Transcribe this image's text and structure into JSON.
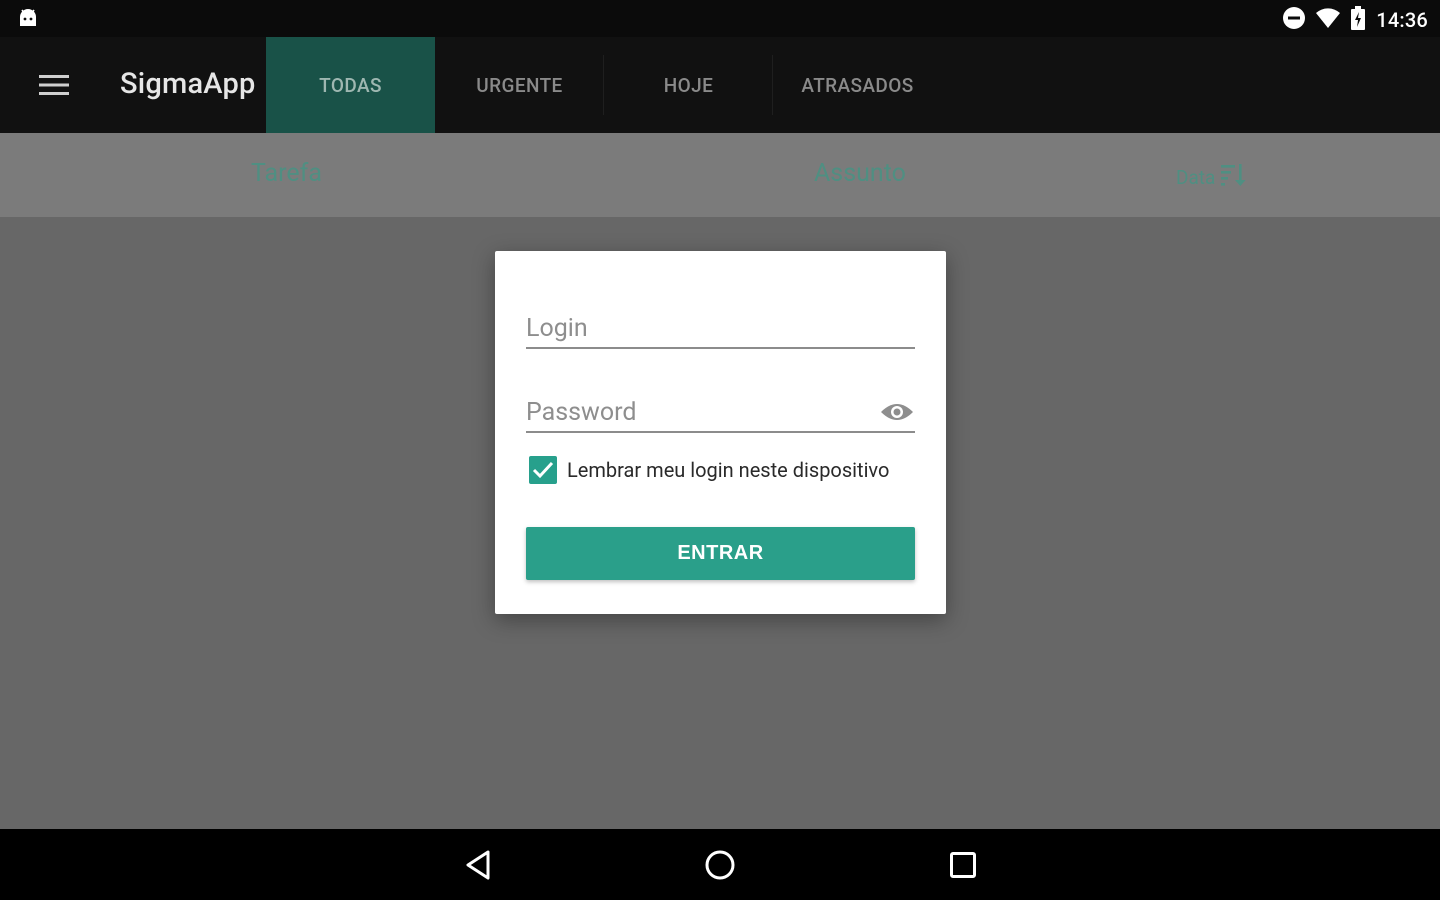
{
  "status_bar": {
    "time": "14:36",
    "icons": [
      "android-icon",
      "dnd-icon",
      "wifi-icon",
      "battery-icon"
    ]
  },
  "app_bar": {
    "title": "SigmaApp",
    "tabs": [
      {
        "label": "TODAS",
        "active": true
      },
      {
        "label": "URGENTE",
        "active": false
      },
      {
        "label": "HOJE",
        "active": false
      },
      {
        "label": "ATRASADOS",
        "active": false
      }
    ]
  },
  "list_header": {
    "tarefa": "Tarefa",
    "assunto": "Assunto",
    "data": "Data"
  },
  "login_dialog": {
    "login_placeholder": "Login",
    "password_placeholder": "Password",
    "remember_label": "Lembrar meu login neste dispositivo",
    "remember_checked": true,
    "submit_label": "ENTRAR"
  },
  "colors": {
    "accent": "#2a9f8a",
    "active_tab": "#195248",
    "header_text": "#4f8f82"
  }
}
